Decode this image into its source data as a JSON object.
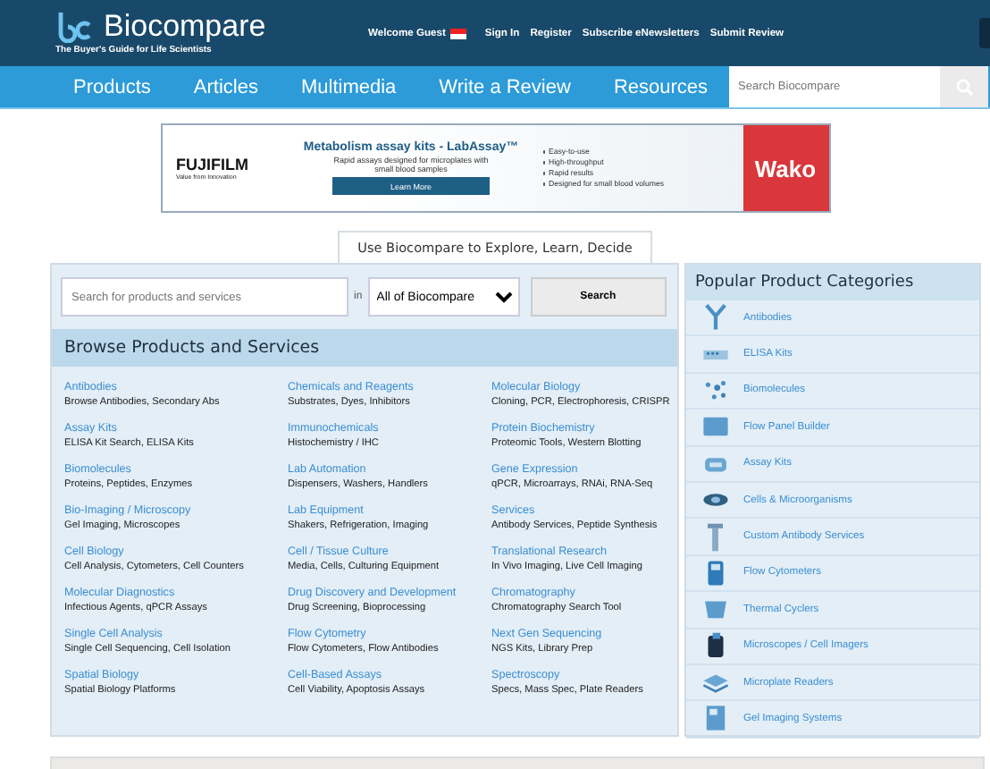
{
  "header": {
    "logo": {
      "name": "Biocompare",
      "tagline": "The Buyer's Guide for Life Scientists"
    },
    "top_links": [
      {
        "label": "Welcome Guest",
        "kind": "text"
      },
      {
        "label": "Sign In",
        "kind": "link"
      },
      {
        "label": "Register",
        "kind": "link"
      },
      {
        "label": "Subscribe eNewsletters",
        "kind": "link"
      },
      {
        "label": "Submit Review",
        "kind": "link"
      }
    ]
  },
  "nav": {
    "items": [
      "Products",
      "Articles",
      "Multimedia",
      "Write a Review",
      "Resources"
    ],
    "search": {
      "placeholder": "Search Biocompare"
    }
  },
  "ad": {
    "brand": "FUJIFILM",
    "brand_tagline": "Value from Innovation",
    "headline": "Metabolism assay kits - LabAssay™",
    "subline": "Rapid assays designed for microplates with small blood samples",
    "button": "Learn More",
    "bullets": [
      "Easy-to-use",
      "High-throughput",
      "Rapid results",
      "Designed for small blood volumes"
    ],
    "partner": "Wako"
  },
  "tagline": "Use Biocompare to Explore, Learn, Decide",
  "search": {
    "placeholder": "Search for products and services",
    "in_label": "in",
    "scope": "All of Biocompare",
    "button": "Search"
  },
  "browse": {
    "title": "Browse Products and Services",
    "categories": [
      {
        "name": "Antibodies",
        "desc": "Browse Antibodies, Secondary Abs"
      },
      {
        "name": "Chemicals and Reagents",
        "desc": "Substrates, Dyes, Inhibitors"
      },
      {
        "name": "Molecular Biology",
        "desc": "Cloning, PCR, Electrophoresis, CRISPR"
      },
      {
        "name": "Assay Kits",
        "desc": "ELISA Kit Search, ELISA Kits"
      },
      {
        "name": "Immunochemicals",
        "desc": "Histochemistry / IHC"
      },
      {
        "name": "Protein Biochemistry",
        "desc": "Proteomic Tools, Western Blotting"
      },
      {
        "name": "Biomolecules",
        "desc": "Proteins, Peptides, Enzymes"
      },
      {
        "name": "Lab Automation",
        "desc": "Dispensers, Washers, Handlers"
      },
      {
        "name": "Gene Expression",
        "desc": "qPCR, Microarrays, RNAi, RNA-Seq"
      },
      {
        "name": "Bio-Imaging / Microscopy",
        "desc": "Gel Imaging, Microscopes"
      },
      {
        "name": "Lab Equipment",
        "desc": "Shakers, Refrigeration, Imaging"
      },
      {
        "name": "Services",
        "desc": "Antibody Services, Peptide Synthesis"
      },
      {
        "name": "Cell Biology",
        "desc": "Cell Analysis, Cytometers, Cell Counters"
      },
      {
        "name": "Cell / Tissue Culture",
        "desc": "Media, Cells, Culturing Equipment"
      },
      {
        "name": "Translational Research",
        "desc": "In Vivo Imaging, Live Cell Imaging"
      },
      {
        "name": "Molecular Diagnostics",
        "desc": "Infectious Agents, qPCR Assays"
      },
      {
        "name": "Drug Discovery and Development",
        "desc": "Drug Screening, Bioprocessing"
      },
      {
        "name": "Chromatography",
        "desc": "Chromatography Search Tool"
      },
      {
        "name": "Single Cell Analysis",
        "desc": "Single Cell Sequencing, Cell Isolation"
      },
      {
        "name": "Flow Cytometry",
        "desc": "Flow Cytometers, Flow Antibodies"
      },
      {
        "name": "Next Gen Sequencing",
        "desc": "NGS Kits, Library Prep"
      },
      {
        "name": "Spatial Biology",
        "desc": "Spatial Biology Platforms"
      },
      {
        "name": "Cell-Based Assays",
        "desc": "Cell Viability, Apoptosis Assays"
      },
      {
        "name": "Spectroscopy",
        "desc": "Specs, Mass Spec, Plate Readers"
      }
    ]
  },
  "popular": {
    "title": "Popular Product Categories",
    "items": [
      {
        "label": "Antibodies",
        "kind": "antibody"
      },
      {
        "label": "ELISA Kits",
        "kind": "plate"
      },
      {
        "label": "Biomolecules",
        "kind": "molecule"
      },
      {
        "label": "Flow Panel Builder",
        "kind": "panel"
      },
      {
        "label": "Assay Kits",
        "kind": "kit"
      },
      {
        "label": "Cells & Microorganisms",
        "kind": "cell"
      },
      {
        "label": "Custom Antibody Services",
        "kind": "tube"
      },
      {
        "label": "Flow Cytometers",
        "kind": "cytometer"
      },
      {
        "label": "Thermal Cyclers",
        "kind": "cycler"
      },
      {
        "label": "Microscopes / Cell Imagers",
        "kind": "imager"
      },
      {
        "label": "Microplate Readers",
        "kind": "reader"
      },
      {
        "label": "Gel Imaging Systems",
        "kind": "gel"
      }
    ]
  }
}
